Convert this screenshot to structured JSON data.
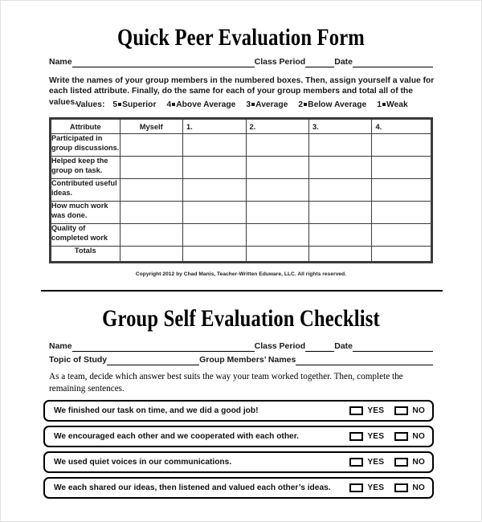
{
  "section1": {
    "title": "Quick Peer Evaluation Form",
    "name_label": "Name",
    "class_period_label": "Class Period",
    "date_label": "Date",
    "instructions": "Write the names of your group members in the numbered boxes.  Then,  assign yourself a value for each listed attribute.  Finally, do the same for each of your group members and total all of the values.",
    "values_label": "Values:",
    "value_scale": [
      {
        "number": "5",
        "meaning": "Superior"
      },
      {
        "number": "4",
        "meaning": "Above Average"
      },
      {
        "number": "3",
        "meaning": "Average"
      },
      {
        "number": "2",
        "meaning": "Below Average"
      },
      {
        "number": "1",
        "meaning": "Weak"
      }
    ],
    "table": {
      "headers": [
        "Attribute",
        "Myself",
        "1.",
        "2.",
        "3.",
        "4."
      ],
      "rows": [
        "Participated in group discussions.",
        "Helped keep the group on task.",
        "Contributed useful ideas.",
        "How much work was done.",
        "Quality of completed work"
      ],
      "totals_label": "Totals"
    },
    "copyright": "Copyright 2012 by Chad Manis, Teacher-Written Eduware, LLC.  All rights reserved."
  },
  "section2": {
    "title": "Group Self Evaluation Checklist",
    "name_label": "Name",
    "class_period_label": "Class Period",
    "date_label": "Date",
    "topic_label": "Topic of Study",
    "group_members_label": "Group Members’ Names",
    "instructions": "As a team, decide which answer best suits the way your team worked together.  Then, complete the remaining sentences.",
    "yes_label": "YES",
    "no_label": "NO",
    "checklist": [
      "We finished our task on time, and we did a good job!",
      "We encouraged each other and we cooperated with each other.",
      "We used quiet voices in our communications.",
      "We each shared our ideas, then listened and valued each other’s ideas."
    ]
  },
  "colors": {
    "ink": "#000000",
    "table_border": "#3b3b3b",
    "page": "#ffffff"
  }
}
